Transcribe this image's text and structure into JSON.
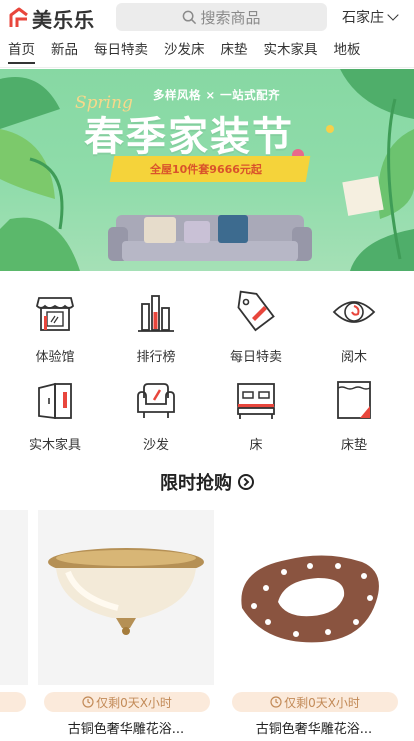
{
  "header": {
    "logo_text": "美乐乐",
    "search_placeholder": "搜索商品",
    "city": "石家庄"
  },
  "nav": {
    "tabs": [
      "首页",
      "新品",
      "每日特卖",
      "沙发床",
      "床垫",
      "实木家具",
      "地板"
    ]
  },
  "banner": {
    "spring": "Spring",
    "subtitle": "多样风格 × 一站式配齐",
    "title": "春季家装节",
    "promo": "全屋10件套9666元起"
  },
  "categories": [
    {
      "label": "体验馆",
      "icon": "store-icon"
    },
    {
      "label": "排行榜",
      "icon": "ranking-icon"
    },
    {
      "label": "每日特卖",
      "icon": "price-tag-icon"
    },
    {
      "label": "阅木",
      "icon": "eye-icon"
    },
    {
      "label": "实木家具",
      "icon": "wardrobe-icon"
    },
    {
      "label": "沙发",
      "icon": "armchair-icon"
    },
    {
      "label": "床",
      "icon": "bed-icon"
    },
    {
      "label": "床垫",
      "icon": "mattress-icon"
    }
  ],
  "flash_sale": {
    "title": "限时抢购",
    "products": [
      {
        "timer": "仅剩0天X小时",
        "title": "古铜色奢华雕花浴...",
        "image": "ceiling-lamp"
      },
      {
        "timer": "仅剩0天X小时",
        "title": "古铜色奢华雕花浴...",
        "image": "toilet-seat-cover"
      }
    ]
  },
  "colors": {
    "accent": "#e8463c",
    "banner_green": "#8fdcaa",
    "timer_bg": "#fbeadb",
    "timer_text": "#c28a57"
  }
}
